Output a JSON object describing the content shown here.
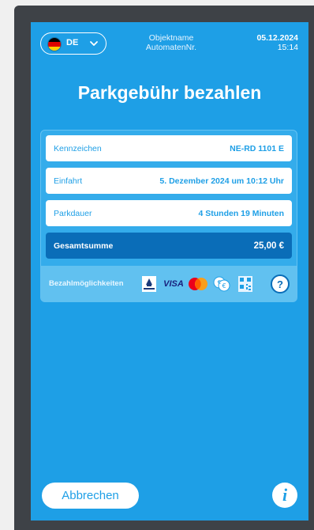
{
  "header": {
    "language": {
      "code": "DE",
      "flag_colors": [
        "#000000",
        "#dd0000",
        "#ffcc00"
      ]
    },
    "object_name": "Objektname",
    "machine_nr": "AutomatenNr.",
    "date": "05.12.2024",
    "time": "15:14"
  },
  "title": "Parkgebühr bezahlen",
  "details": [
    {
      "label": "Kennzeichen",
      "value": "NE-RD 1101 E"
    },
    {
      "label": "Einfahrt",
      "value": "5. Dezember 2024 um 10:12 Uhr"
    },
    {
      "label": "Parkdauer",
      "value": "4 Stunden 19 Minuten"
    }
  ],
  "total": {
    "label": "Gesamtsumme",
    "value": "25,00 €"
  },
  "payment": {
    "label": "Bezahlmöglichkeiten",
    "methods": [
      {
        "icon": "girocard-icon",
        "text": "girocard"
      },
      {
        "icon": "visa-icon",
        "text": "VISA"
      },
      {
        "icon": "mastercard-icon"
      },
      {
        "icon": "coins-icon"
      },
      {
        "icon": "qr-code-icon"
      }
    ],
    "help": "?"
  },
  "footer": {
    "cancel": "Abbrechen",
    "info": "i"
  },
  "colors": {
    "screen_bg": "#1e9fe6",
    "total_bg": "#0a6db8",
    "bezel": "#3e4247"
  }
}
